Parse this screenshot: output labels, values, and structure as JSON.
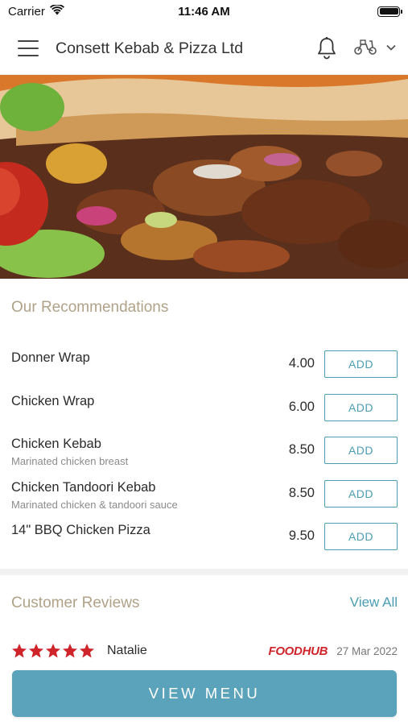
{
  "status_bar": {
    "carrier": "Carrier",
    "time": "11:46 AM"
  },
  "header": {
    "title": "Consett Kebab & Pizza Ltd",
    "icons": [
      "menu-icon",
      "bell-icon",
      "scooter-icon",
      "chevron-down-icon"
    ]
  },
  "recommendations": {
    "title": "Our Recommendations",
    "items": [
      {
        "name": "Donner Wrap",
        "description": "",
        "price": "4.00",
        "button": "ADD"
      },
      {
        "name": "Chicken Wrap",
        "description": "",
        "price": "6.00",
        "button": "ADD"
      },
      {
        "name": "Chicken Kebab",
        "description": "Marinated chicken breast",
        "price": "8.50",
        "button": "ADD"
      },
      {
        "name": "Chicken Tandoori Kebab",
        "description": "Marinated chicken & tandoori sauce",
        "price": "8.50",
        "button": "ADD"
      },
      {
        "name": "14\" BBQ Chicken Pizza",
        "description": "",
        "price": "9.50",
        "button": "ADD"
      }
    ]
  },
  "reviews": {
    "title": "Customer Reviews",
    "view_all": "View All",
    "items": [
      {
        "rating": 5,
        "name": "Natalie",
        "source": "FOODHUB",
        "date": "27 Mar 2022"
      }
    ]
  },
  "footer": {
    "view_menu": "VIEW MENU"
  },
  "colors": {
    "accent": "#4b9db3",
    "button_bg": "#5ba3ba",
    "section_title": "#b0a287",
    "star": "#d0242b",
    "brand_foodhub": "#d0242b"
  }
}
